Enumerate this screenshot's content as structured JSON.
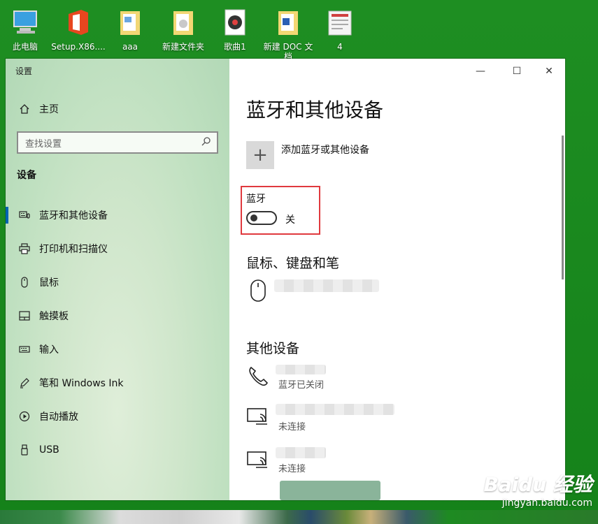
{
  "desktop": {
    "icons": [
      {
        "label": "此电脑",
        "icon": "computer-icon"
      },
      {
        "label": "Setup.X86....",
        "icon": "office-icon"
      },
      {
        "label": "aaa",
        "icon": "folder-icon"
      },
      {
        "label": "新建文件夹",
        "icon": "folder-icon"
      },
      {
        "label": "歌曲1",
        "icon": "music-icon"
      },
      {
        "label": "新建 DOC 文档",
        "icon": "word-doc-icon"
      },
      {
        "label": "4",
        "icon": "image-file-icon"
      }
    ]
  },
  "window": {
    "app_title": "设置",
    "home_label": "主页",
    "search_placeholder": "查找设置",
    "section_label": "设备",
    "nav": [
      {
        "label": "蓝牙和其他设备",
        "icon": "keyboard-mouse-icon",
        "active": true
      },
      {
        "label": "打印机和扫描仪",
        "icon": "printer-icon"
      },
      {
        "label": "鼠标",
        "icon": "mouse-icon"
      },
      {
        "label": "触摸板",
        "icon": "touchpad-icon"
      },
      {
        "label": "输入",
        "icon": "keyboard-icon"
      },
      {
        "label": "笔和 Windows Ink",
        "icon": "pen-icon"
      },
      {
        "label": "自动播放",
        "icon": "autoplay-icon"
      },
      {
        "label": "USB",
        "icon": "usb-icon"
      }
    ],
    "controls": {
      "minimize": "—",
      "maximize": "☐",
      "close": "✕"
    }
  },
  "main": {
    "page_title": "蓝牙和其他设备",
    "add_device_label": "添加蓝牙或其他设备",
    "bluetooth": {
      "label": "蓝牙",
      "state_label": "关",
      "on": false
    },
    "mouse_section_title": "鼠标、键盘和笔",
    "other_section_title": "其他设备",
    "other_devices": [
      {
        "icon": "phone-icon",
        "status": "蓝牙已关闭"
      },
      {
        "icon": "display-device-icon",
        "status": "未连接"
      },
      {
        "icon": "display-device-icon",
        "status": "未连接"
      }
    ]
  },
  "watermark": {
    "brand": "Baidu 经验",
    "url": "jingyan.baidu.com"
  },
  "colors": {
    "accent": "#0063b1",
    "highlight_box": "#e0393e",
    "desktop": "#1e8e22"
  }
}
